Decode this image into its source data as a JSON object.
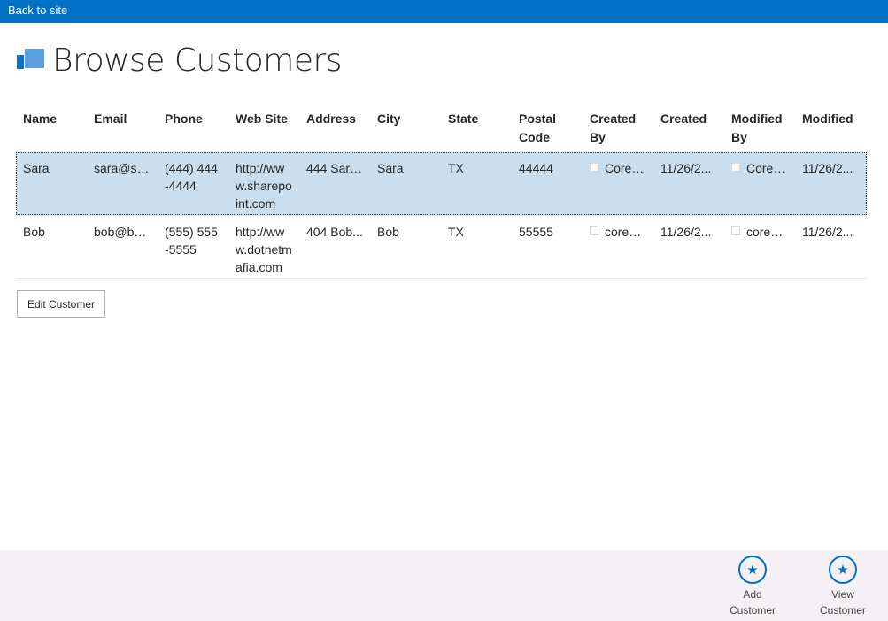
{
  "topbar": {
    "back_label": "Back to site"
  },
  "page": {
    "title": "Browse Customers"
  },
  "table": {
    "headers": [
      "Name",
      "Email",
      "Phone",
      "Web Site",
      "Address",
      "City",
      "State",
      "Postal Code",
      "Created By",
      "Created",
      "Modified By",
      "Modified"
    ],
    "rows": [
      {
        "name": "Sara",
        "email": "sara@sa...",
        "phone": "(444) 444-4444",
        "website": "http://www.sharepoint.com",
        "address": "444 Sara...",
        "city": "Sara",
        "state": "TX",
        "postal": "44444",
        "created_by": "Corey...",
        "created": "11/26/2...",
        "modified_by": "Corey...",
        "modified": "11/26/2..."
      },
      {
        "name": "Bob",
        "email": "bob@bo...",
        "phone": "(555) 555-5555",
        "website": "http://www.dotnetmafia.com",
        "address": "404 Bob...",
        "city": "Bob",
        "state": "TX",
        "postal": "55555",
        "created_by": "corey@s",
        "created": "11/26/2...",
        "modified_by": "corey@s",
        "modified": "11/26/2..."
      }
    ],
    "selected_row": 0
  },
  "actions": {
    "edit_label": "Edit Customer"
  },
  "commandbar": {
    "add": {
      "label_line1": "Add",
      "label_line2": "Customer",
      "icon": "star-icon"
    },
    "view": {
      "label_line1": "View",
      "label_line2": "Customer",
      "icon": "star-icon"
    }
  },
  "colors": {
    "accent": "#0072c6",
    "selected_row": "#c9deef",
    "commandbar_bg": "#f4f0f4"
  }
}
